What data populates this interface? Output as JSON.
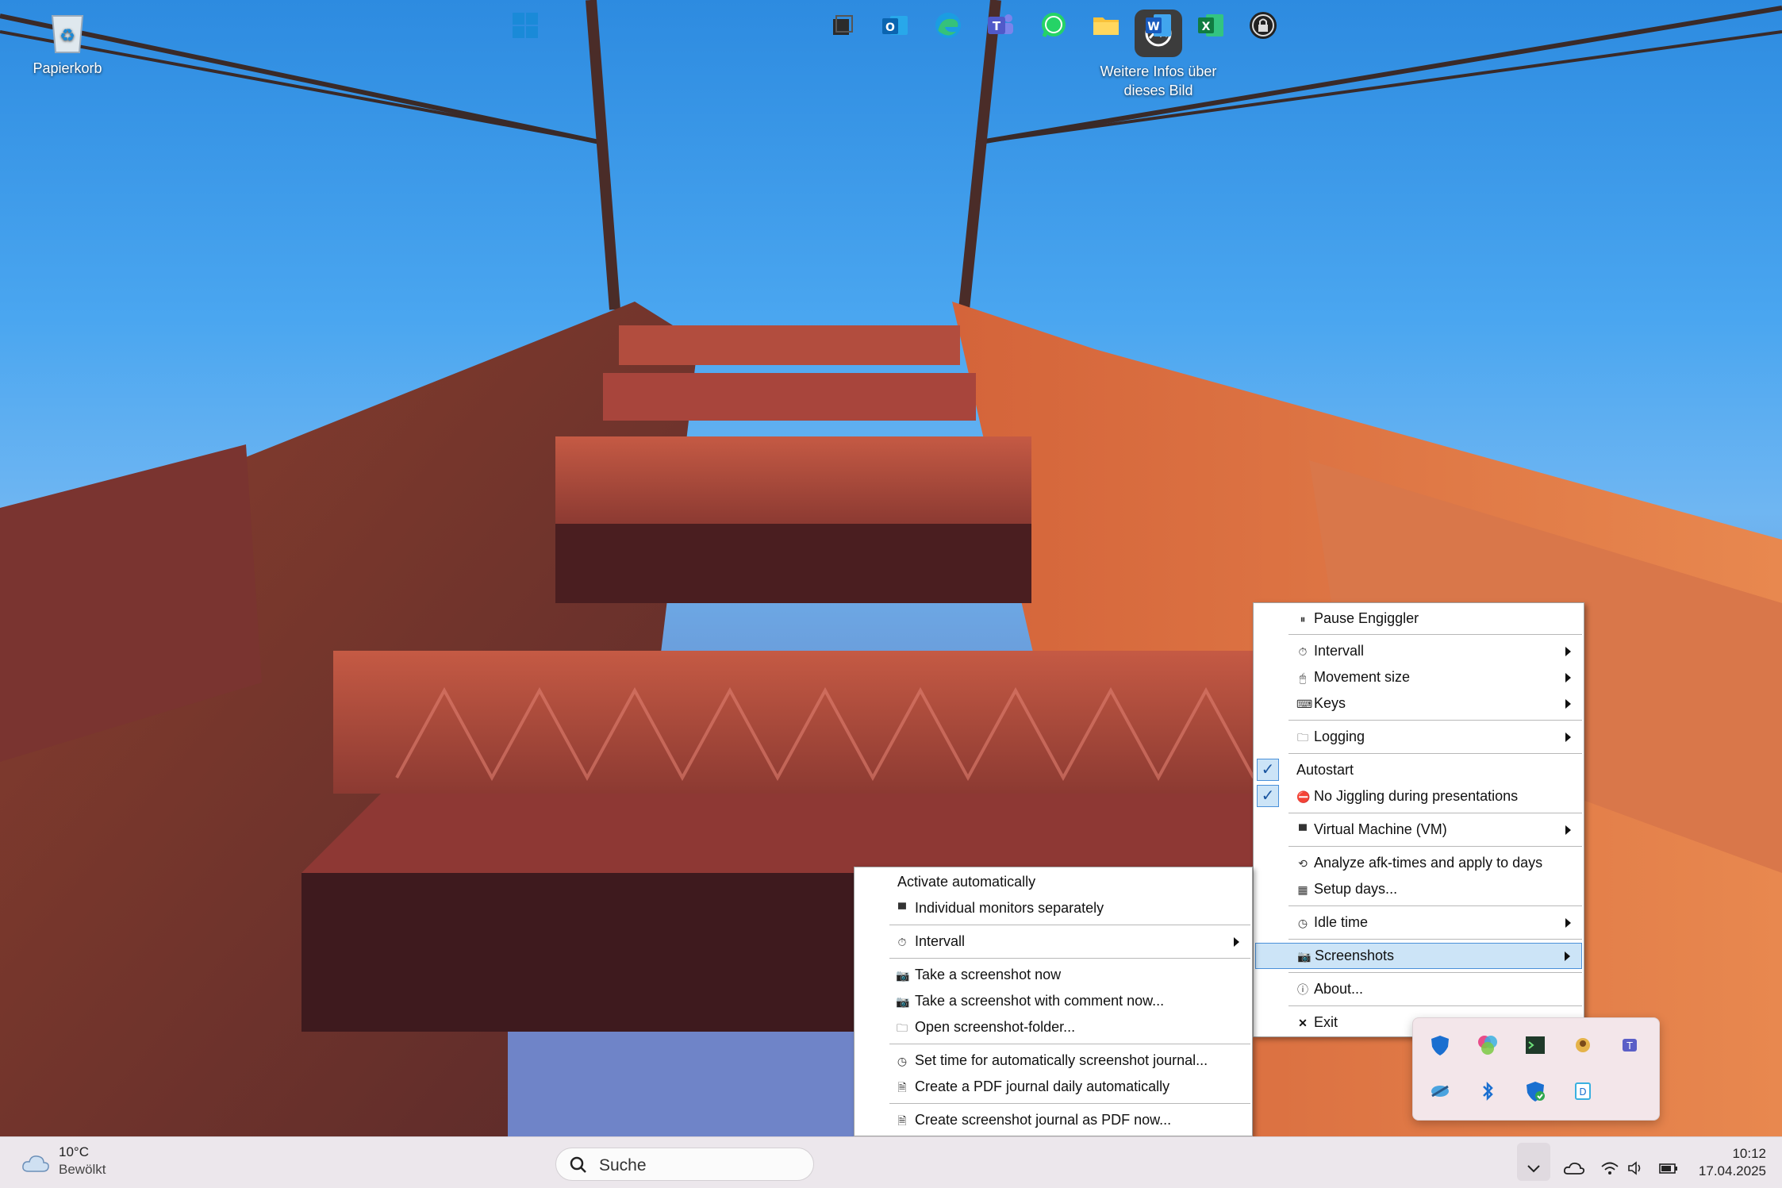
{
  "desktop_icons": [
    {
      "label": "Papierkorb",
      "icon": "recycle-bin-icon"
    },
    {
      "label": "Weitere Infos über\ndieses Bild",
      "icon": "image-info-icon"
    }
  ],
  "main_menu": {
    "items": [
      {
        "label": "Pause Engiggler",
        "icon": "pause-icon"
      },
      {
        "label": "Intervall",
        "icon": "timer-icon",
        "submenu": true
      },
      {
        "label": "Movement size",
        "icon": "mouse-icon",
        "submenu": true
      },
      {
        "label": "Keys",
        "icon": "keyboard-icon",
        "submenu": true
      },
      {
        "label": "Logging",
        "icon": "folder-icon",
        "submenu": true
      },
      {
        "label": "Autostart",
        "checked": true
      },
      {
        "label": "No Jiggling during presentations",
        "icon": "no-entry-icon",
        "checked": true
      },
      {
        "label": "Virtual Machine (VM)",
        "icon": "monitor-icon",
        "submenu": true
      },
      {
        "label": "Analyze afk-times and apply to days",
        "icon": "analyze-icon"
      },
      {
        "label": "Setup days...",
        "icon": "calendar-icon"
      },
      {
        "label": "Idle time",
        "icon": "clock-icon",
        "submenu": true
      },
      {
        "label": "Screenshots",
        "icon": "camera-icon",
        "submenu": true,
        "highlighted": true
      },
      {
        "label": "About...",
        "icon": "info-icon"
      },
      {
        "label": "Exit",
        "icon": "close-icon"
      }
    ]
  },
  "screenshots_submenu": {
    "items": [
      {
        "label": "Activate automatically"
      },
      {
        "label": "Individual monitors separately",
        "icon": "monitor-icon"
      },
      {
        "label": "Intervall",
        "icon": "timer-icon",
        "submenu": true
      },
      {
        "label": "Take a screenshot now",
        "icon": "camera-icon"
      },
      {
        "label": "Take a screenshot with comment now...",
        "icon": "camera-icon"
      },
      {
        "label": "Open screenshot-folder...",
        "icon": "folder-icon"
      },
      {
        "label": "Set time for automatically screenshot journal...",
        "icon": "clock-icon"
      },
      {
        "label": "Create a PDF journal daily automatically",
        "icon": "document-icon"
      },
      {
        "label": "Create screenshot journal as PDF now...",
        "icon": "document-icon"
      }
    ]
  },
  "tray_overflow_icons": [
    "defender-shield-icon",
    "colorful-app-icon",
    "terminal-app-icon",
    "bug-app-icon",
    "teams-icon",
    "snipping-icon",
    "bluetooth-icon",
    "security-check-icon",
    "dictation-icon"
  ],
  "taskbar": {
    "weather": {
      "temp": "10°C",
      "condition": "Bewölkt",
      "icon": "cloud-icon"
    },
    "search_placeholder": "Suche",
    "apps": [
      "start-icon",
      "task-view-icon",
      "outlook-icon",
      "edge-icon",
      "teams-icon",
      "whatsapp-icon",
      "file-explorer-icon",
      "word-icon",
      "excel-icon",
      "lock-app-icon"
    ],
    "system_tray": {
      "icons": [
        "chevron-up-icon",
        "onedrive-icon",
        "wifi-icon",
        "speaker-icon",
        "battery-icon"
      ],
      "time": "10:12",
      "date": "17.04.2025"
    }
  },
  "colors": {
    "menu_highlight": "#cce4f7",
    "menu_highlight_border": "#4a90d9",
    "bridge": "#c8603c",
    "sky": "#4aa6f0"
  }
}
